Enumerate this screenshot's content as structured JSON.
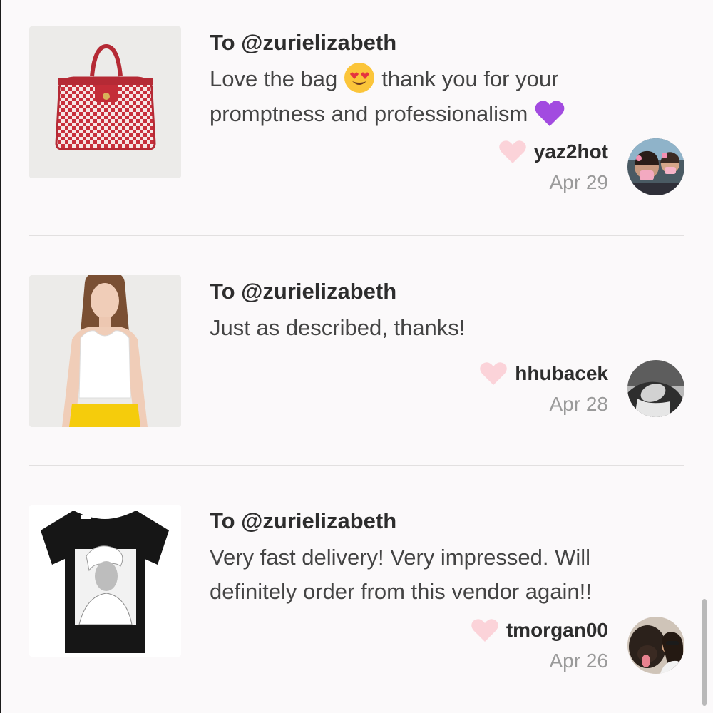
{
  "reviews": [
    {
      "to": "To @zurielizabeth",
      "comment_before": "Love the bag",
      "comment_after": "thank you for your promptness and professionalism",
      "username": "yaz2hot",
      "date": "Apr 29",
      "product_image": "red-houndstooth-bag-photo",
      "avatar": "user-avatar-photo"
    },
    {
      "to": "To @zurielizabeth",
      "comment": "Just as described, thanks!",
      "username": "hhubacek",
      "date": "Apr 28",
      "product_image": "white-crop-top-photo",
      "avatar": "user-avatar-photo"
    },
    {
      "to": "To @zurielizabeth",
      "comment": "Very fast delivery! Very impressed. Will definitely order from this vendor again!!",
      "username": "tmorgan00",
      "date": "Apr 26",
      "product_image": "black-graphic-tshirt-photo",
      "avatar": "user-avatar-photo"
    }
  ],
  "icons": {
    "like": "heart-icon",
    "emoji_1": "heart-eyes-emoji",
    "emoji_2": "purple-heart-emoji"
  },
  "colors": {
    "heart": "#fbd3d9",
    "text": "#444444",
    "muted": "#9a9a9a"
  }
}
